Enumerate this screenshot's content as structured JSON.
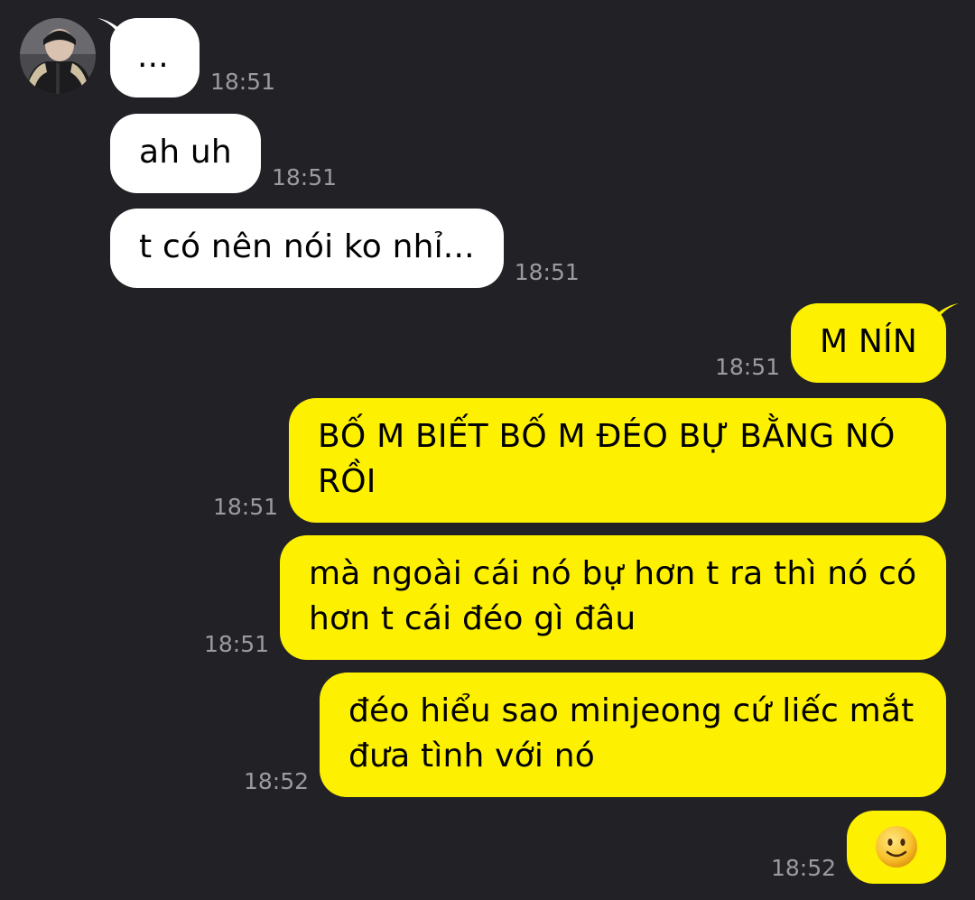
{
  "conversation": {
    "contact_avatar": "avatar-photo",
    "messages": [
      {
        "side": "incoming",
        "text": "...",
        "time": "18:51"
      },
      {
        "side": "incoming",
        "text": "ah uh",
        "time": "18:51"
      },
      {
        "side": "incoming",
        "text": "t có nên nói ko nhỉ...",
        "time": "18:51"
      },
      {
        "side": "outgoing",
        "text": "M NÍN",
        "time": "18:51"
      },
      {
        "side": "outgoing",
        "text": "BỐ M BIẾT BỐ M ĐÉO BỰ BẰNG NÓ RỒI",
        "time": "18:51"
      },
      {
        "side": "outgoing",
        "text": "mà ngoài cái nó bự hơn t ra thì nó có hơn t cái đéo gì đâu",
        "time": "18:51"
      },
      {
        "side": "outgoing",
        "text": "đéo hiểu sao minjeong cứ liếc mắt đưa tình với nó",
        "time": "18:52"
      },
      {
        "side": "outgoing",
        "text": "",
        "emoji": "slightly-smiling-face-icon",
        "time": "18:52"
      }
    ]
  },
  "colors": {
    "background": "#222226",
    "incoming_bubble": "#ffffff",
    "outgoing_bubble": "#fdf000",
    "timestamp": "#9a9aa0"
  }
}
